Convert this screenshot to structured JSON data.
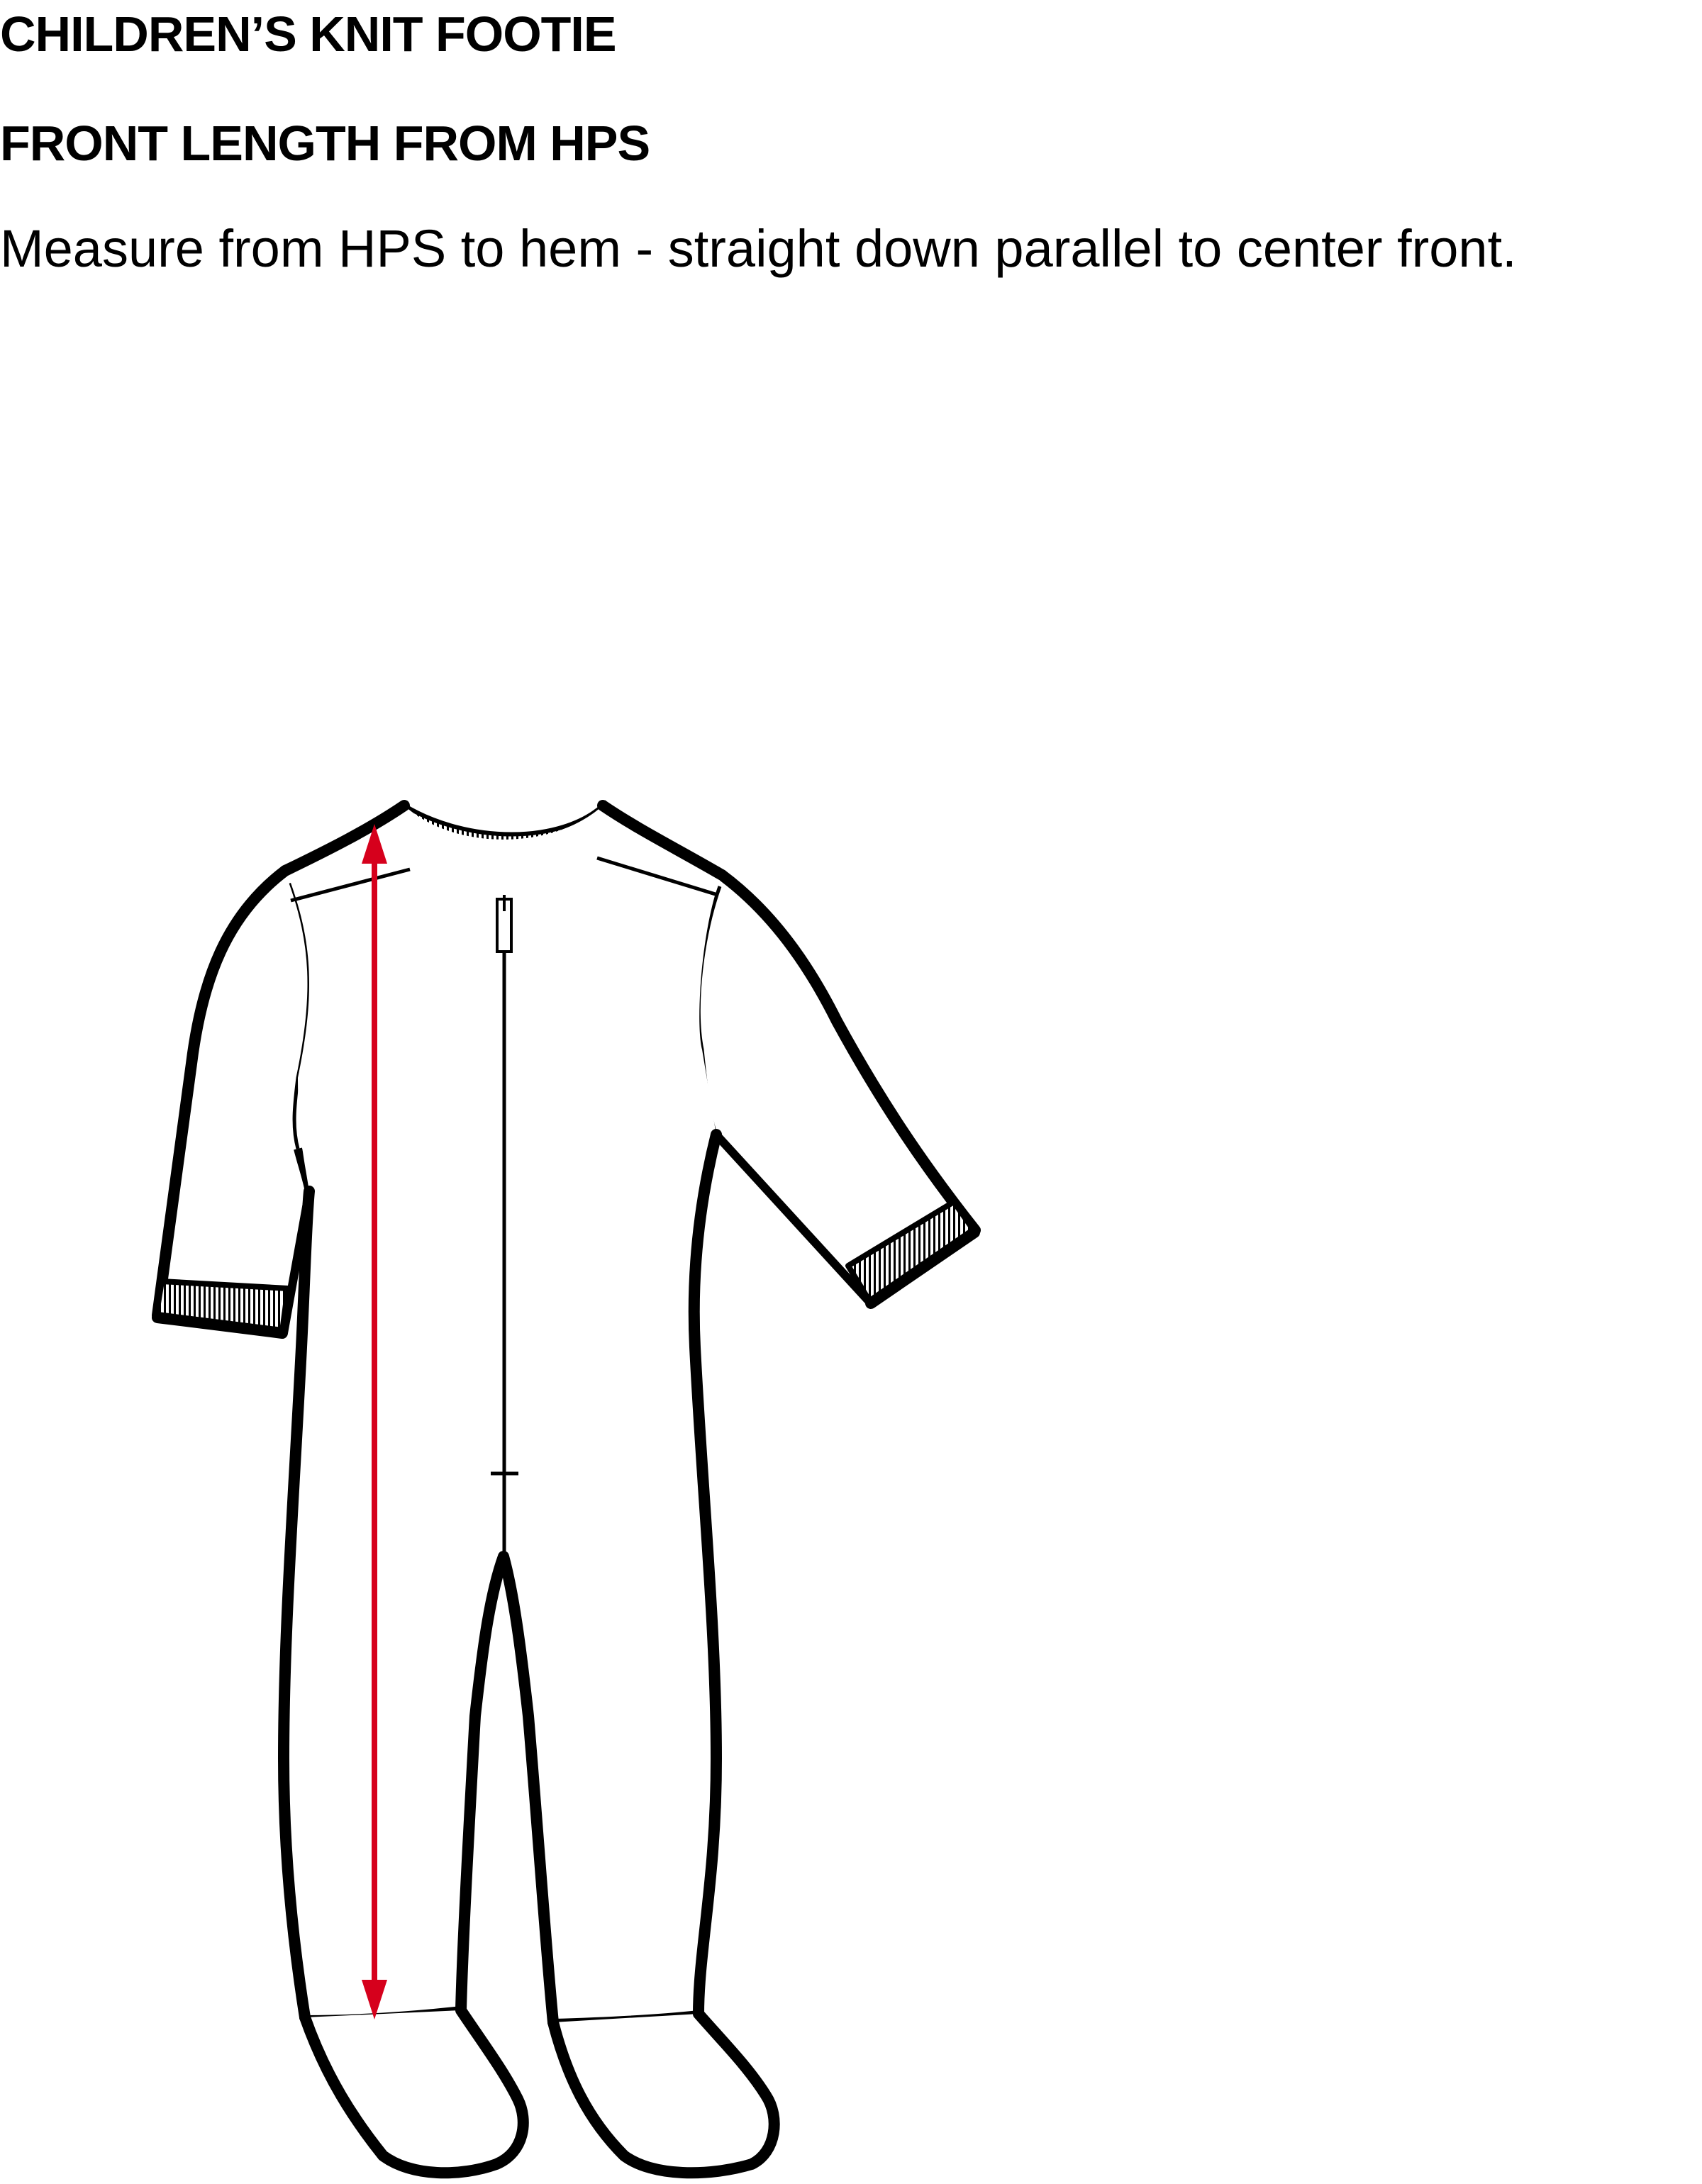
{
  "doc_title": "CHILDREN’S KNIT FOOTIE",
  "section_title": "FRONT LENGTH FROM HPS",
  "instruction": "Measure from HPS to hem - straight down parallel to center front.",
  "colors": {
    "outline": "#000000",
    "measure_arrow": "#d6001c",
    "background": "#ffffff"
  },
  "figure": {
    "garment": "knit footie sleeper, front view",
    "measurement": "front length from HPS"
  }
}
